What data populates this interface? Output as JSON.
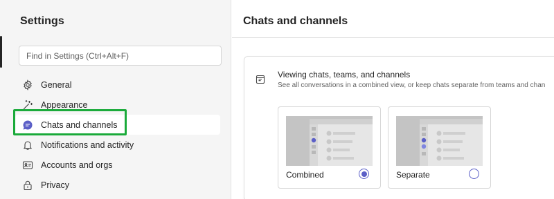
{
  "sidebar": {
    "title": "Settings",
    "search_placeholder": "Find in Settings (Ctrl+Alt+F)",
    "items": [
      {
        "label": "General",
        "icon": "gear-icon"
      },
      {
        "label": "Appearance",
        "icon": "magic-wand-icon"
      },
      {
        "label": "Chats and channels",
        "icon": "chat-bubble-icon",
        "active": true
      },
      {
        "label": "Notifications and activity",
        "icon": "bell-icon"
      },
      {
        "label": "Accounts and orgs",
        "icon": "contact-card-icon"
      },
      {
        "label": "Privacy",
        "icon": "lock-icon"
      }
    ]
  },
  "main": {
    "title": "Chats and channels",
    "card": {
      "icon": "layout-icon",
      "title": "Viewing chats, teams, and channels",
      "subtitle": "See all conversations in a combined view, or keep chats separate from teams and chan",
      "options": [
        {
          "label": "Combined",
          "selected": true
        },
        {
          "label": "Separate",
          "selected": false
        }
      ]
    }
  },
  "colors": {
    "accent": "#5b5fc7",
    "highlight": "#1aaa3a",
    "sidebar_bg": "#f5f5f5"
  }
}
